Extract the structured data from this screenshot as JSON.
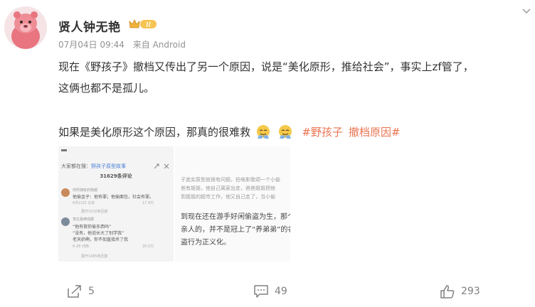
{
  "user": {
    "name": "贤人钟无艳",
    "badge_text": "II",
    "date": "07月04日 09:44",
    "source": "来自 Android"
  },
  "post": {
    "line1": "现在《野孩子》撤档又传出了另一个原因，说是“美化原形，推给社会”，事实上zf管了，",
    "line2": "这俩也都不是孤儿。",
    "line3": "如果是美化原形这个原因，那真的很难救",
    "hashtags": [
      "#野孩子",
      "撤档原因#"
    ]
  },
  "image1": {
    "search_prefix": "大家都在搜：",
    "search_term": "野孩子原型故事",
    "comment_count": "31629条评论",
    "comments": [
      {
        "user": "你所拥有的我都",
        "text": "他偷金子：他有罪；他偷面包，社会有罪。",
        "meta": "6月21日  北京",
        "likes": "17.4万"
      },
      {
        "user": "李庄最棒成都",
        "text1": "“他有救你偷东西吗”",
        "text2": "“没有，他说长大了别学我”",
        "text3": "老天奶啊，你不如直接杀了我",
        "meta": "6-28  河南",
        "likes": "20.5万"
      }
    ],
    "expand1": "展开1010条回复",
    "expand2": "展开1485条回复"
  },
  "image2": {
    "small_lines": [
      "子其实原型就很有问题，拍电影歌颂一个小偷",
      "爸有姐姐，他自己离家出走，爸爸姐姐把他",
      "到姐姐的超市工作，他又自己走了，当小偷",
      ""
    ],
    "big_lines": [
      "到现在还在游手好闲偷盗为生，那个",
      "亲人的，并不是冠上了“养弟弟”的名",
      "盗行为正义化。"
    ]
  },
  "actions": {
    "share_count": "5",
    "comment_count": "49",
    "like_count": "293"
  },
  "colors": {
    "hashtag": "#eb7350",
    "meta": "#939393",
    "text": "#333333"
  },
  "icons": {
    "share": "share-icon",
    "comment": "comment-icon",
    "like": "thumbs-up-icon",
    "menu": "chevron-down-icon"
  }
}
